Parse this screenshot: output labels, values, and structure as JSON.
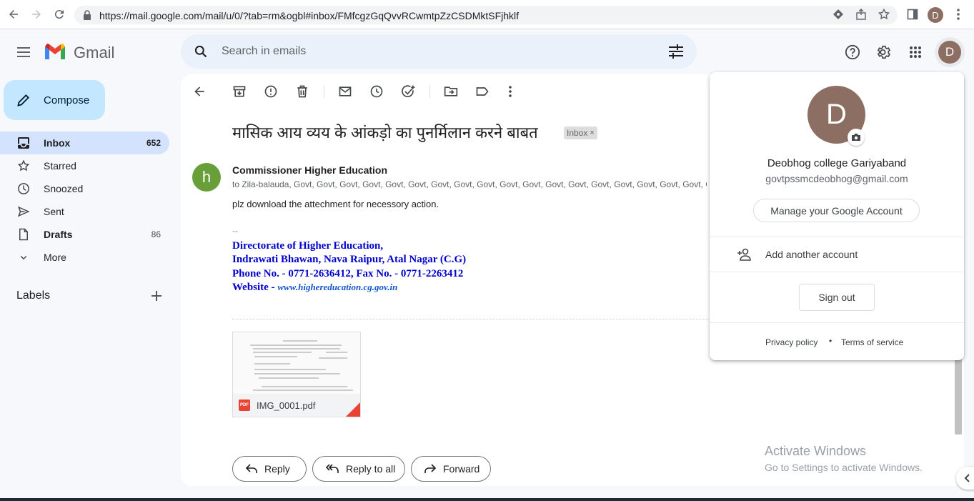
{
  "browser": {
    "url": "https://mail.google.com/mail/u/0/?tab=rm&ogbl#inbox/FMfcgzGqQvvRCwmtpZzCSDMktSFjhklf",
    "profile_initial": "D"
  },
  "header": {
    "app_name": "Gmail",
    "search_placeholder": "Search in emails",
    "account_initial": "D"
  },
  "sidebar": {
    "compose_label": "Compose",
    "items": [
      {
        "label": "Inbox",
        "count": "652"
      },
      {
        "label": "Starred",
        "count": ""
      },
      {
        "label": "Snoozed",
        "count": ""
      },
      {
        "label": "Sent",
        "count": ""
      },
      {
        "label": "Drafts",
        "count": "86"
      },
      {
        "label": "More",
        "count": ""
      }
    ],
    "labels_title": "Labels"
  },
  "email": {
    "subject": "मासिक आय व्यय के आंकड़ो का पुनर्मिलान करने बाबत",
    "label_chip": "Inbox",
    "sender_initial": "h",
    "sender_name": "Commissioner Higher Education",
    "recipients": "to Zila-balauda, Govt, Govt, Govt, Govt, Govt, Govt, Govt, Govt, Govt, Govt, Govt, Govt, Govt, Govt, Govt, Govt, Govt, Govt, Govt,",
    "body": "plz download the attechment for necessory action.",
    "signature_dash": "--",
    "signature": [
      "Directorate of Higher Education,",
      "Indrawati Bhawan, Nava Raipur, Atal Nagar (C.G)",
      "Phone No. - 0771-2636412, Fax No. - 0771-2263412"
    ],
    "website_prefix": "Website - ",
    "website_link": "www.highereducation.cg.gov.in",
    "attachment_name": "IMG_0001.pdf",
    "attachment_type": "PDF",
    "actions": {
      "reply": "Reply",
      "reply_all": "Reply to all",
      "forward": "Forward"
    }
  },
  "account_popup": {
    "initial": "D",
    "name": "Deobhog college Gariyaband",
    "email": "govtpssmcdeobhog@gmail.com",
    "manage_label": "Manage your Google Account",
    "add_account_label": "Add another account",
    "sign_out_label": "Sign out",
    "privacy_label": "Privacy policy",
    "separator": "•",
    "terms_label": "Terms of service"
  },
  "watermark": {
    "title": "Activate Windows",
    "subtitle": "Go to Settings to activate Windows."
  },
  "colors": {
    "accent": "#0b57d0",
    "compose_bg": "#c2e7ff",
    "active_nav": "#d3e3fd",
    "avatar": "#8d6e63",
    "sender_avatar": "#689f38",
    "signature_blue": "#0000cc"
  }
}
